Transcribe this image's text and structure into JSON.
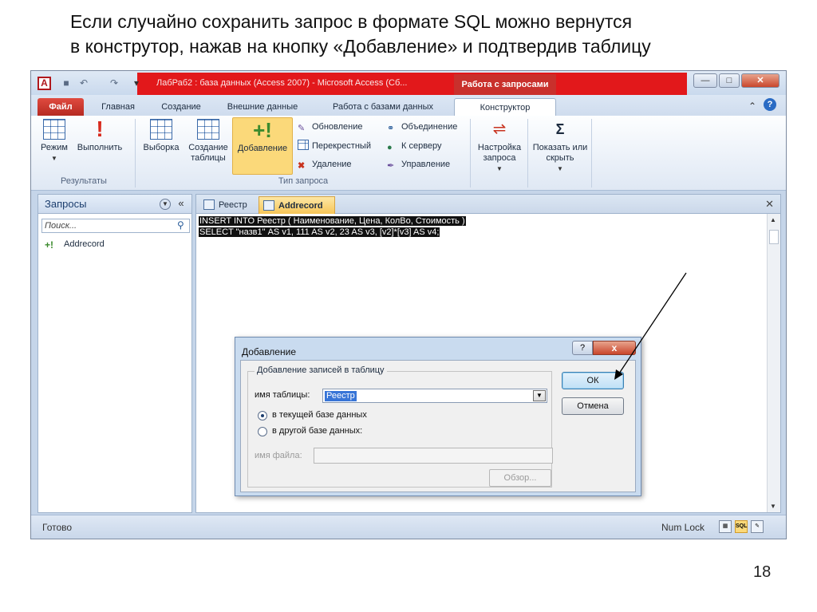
{
  "slide": {
    "heading_line1": "Если случайно сохранить запрос в формате SQL можно вернутся",
    "heading_line2": "в конструтор, нажав на кнопку «Добавление» и подтвердив таблицу",
    "page_number": "18"
  },
  "window": {
    "title": "ЛабРаб2 : база данных (Access 2007)  -  Microsoft Access (Сб...",
    "context_tab_header": "Работа с запросами",
    "app_icon_letter": "A",
    "highlight_color": "#e2181b"
  },
  "ribbon_tabs": [
    {
      "label": "Файл"
    },
    {
      "label": "Главная"
    },
    {
      "label": "Создание"
    },
    {
      "label": "Внешние данные"
    },
    {
      "label": "Работа с базами данных"
    },
    {
      "label": "Конструктор"
    }
  ],
  "ribbon": {
    "results": {
      "mode": "Режим",
      "run": "Выполнить",
      "group": "Результаты"
    },
    "query_type": {
      "select": "Выборка",
      "make_table": "Создание таблицы",
      "append": "Добавление",
      "update": "Обновление",
      "crosstab": "Перекрестный",
      "delete": "Удаление",
      "union": "Объединение",
      "to_server": "К серверу",
      "manage": "Управление",
      "group": "Тип запроса"
    },
    "setup": "Настройка запроса",
    "show_hide": "Показать или скрыть"
  },
  "nav_pane": {
    "title": "Запросы",
    "search_placeholder": "Поиск...",
    "items": [
      "Addrecord"
    ]
  },
  "doc_tabs": [
    {
      "label": "Реестр"
    },
    {
      "label": "Addrecord"
    }
  ],
  "sql_lines": [
    "INSERT INTO Реестр ( Наименование, Цена, КолВо, Стоимость )",
    "SELECT \"назв1\" AS v1, 111 AS v2, 23 AS v3, [v2]*[v3] AS v4;"
  ],
  "status": {
    "ready": "Готово",
    "num_lock": "Num Lock",
    "sql_view": "SQL"
  },
  "dialog": {
    "title": "Добавление",
    "group_label": "Добавление записей в таблицу",
    "table_name_label": "имя таблицы:",
    "table_name_value": "Реестр",
    "current_db": "в текущей базе данных",
    "other_db": "в другой базе данных:",
    "file_name_label": "имя файла:",
    "browse": "Обзор...",
    "ok": "ОК",
    "cancel": "Отмена",
    "help_glyph": "?",
    "close_glyph": "x"
  }
}
